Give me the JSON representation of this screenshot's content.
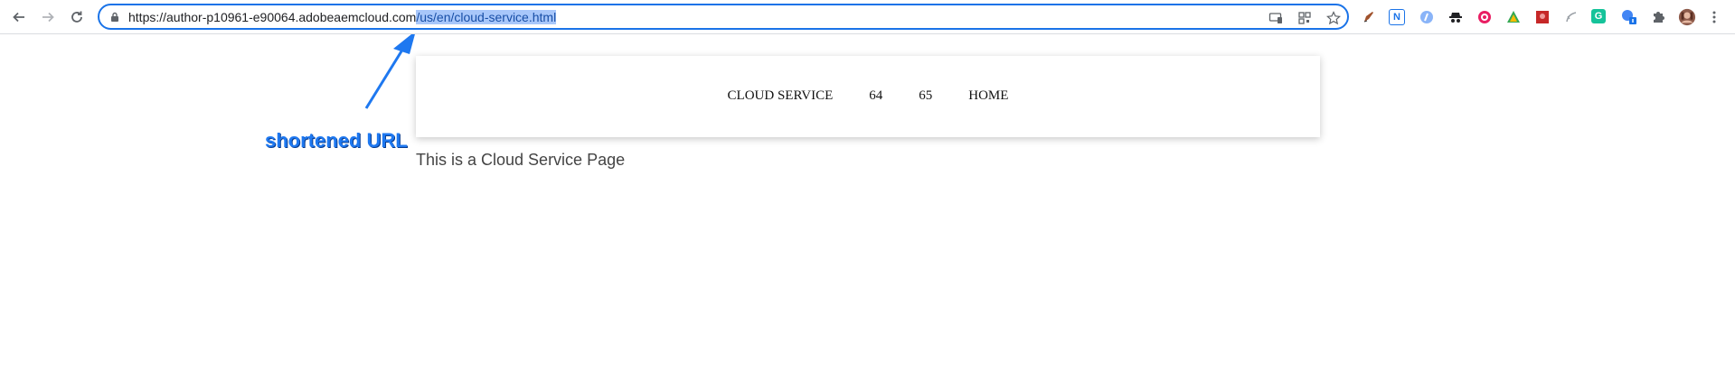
{
  "browser": {
    "url_base": "https://author-p10961-e90064.adobeaemcloud.com",
    "url_path": "/us/en/cloud-service.html",
    "nav_icons": [
      "back-arrow-icon",
      "forward-arrow-icon",
      "reload-icon"
    ],
    "omnibox_icons": [
      "cast-icon",
      "qr-code-icon",
      "star-icon"
    ],
    "extensions": [
      "pen-extension-icon",
      "n-extension-icon",
      "tag-extension-icon",
      "spy-extension-icon",
      "circle-extension-icon",
      "red-square-extension-icon",
      "leaf-extension-icon",
      "g-extension-icon",
      "translate-extension-icon",
      "puzzle-icon",
      "profile-avatar"
    ],
    "accent_color": "#1a73e8"
  },
  "site": {
    "nav": {
      "items": [
        "CLOUD SERVICE",
        "64",
        "65",
        "HOME"
      ]
    },
    "body_text": "This is a Cloud Service Page"
  },
  "annotation": {
    "label": "shortened URL",
    "color": "#1e78f0"
  }
}
